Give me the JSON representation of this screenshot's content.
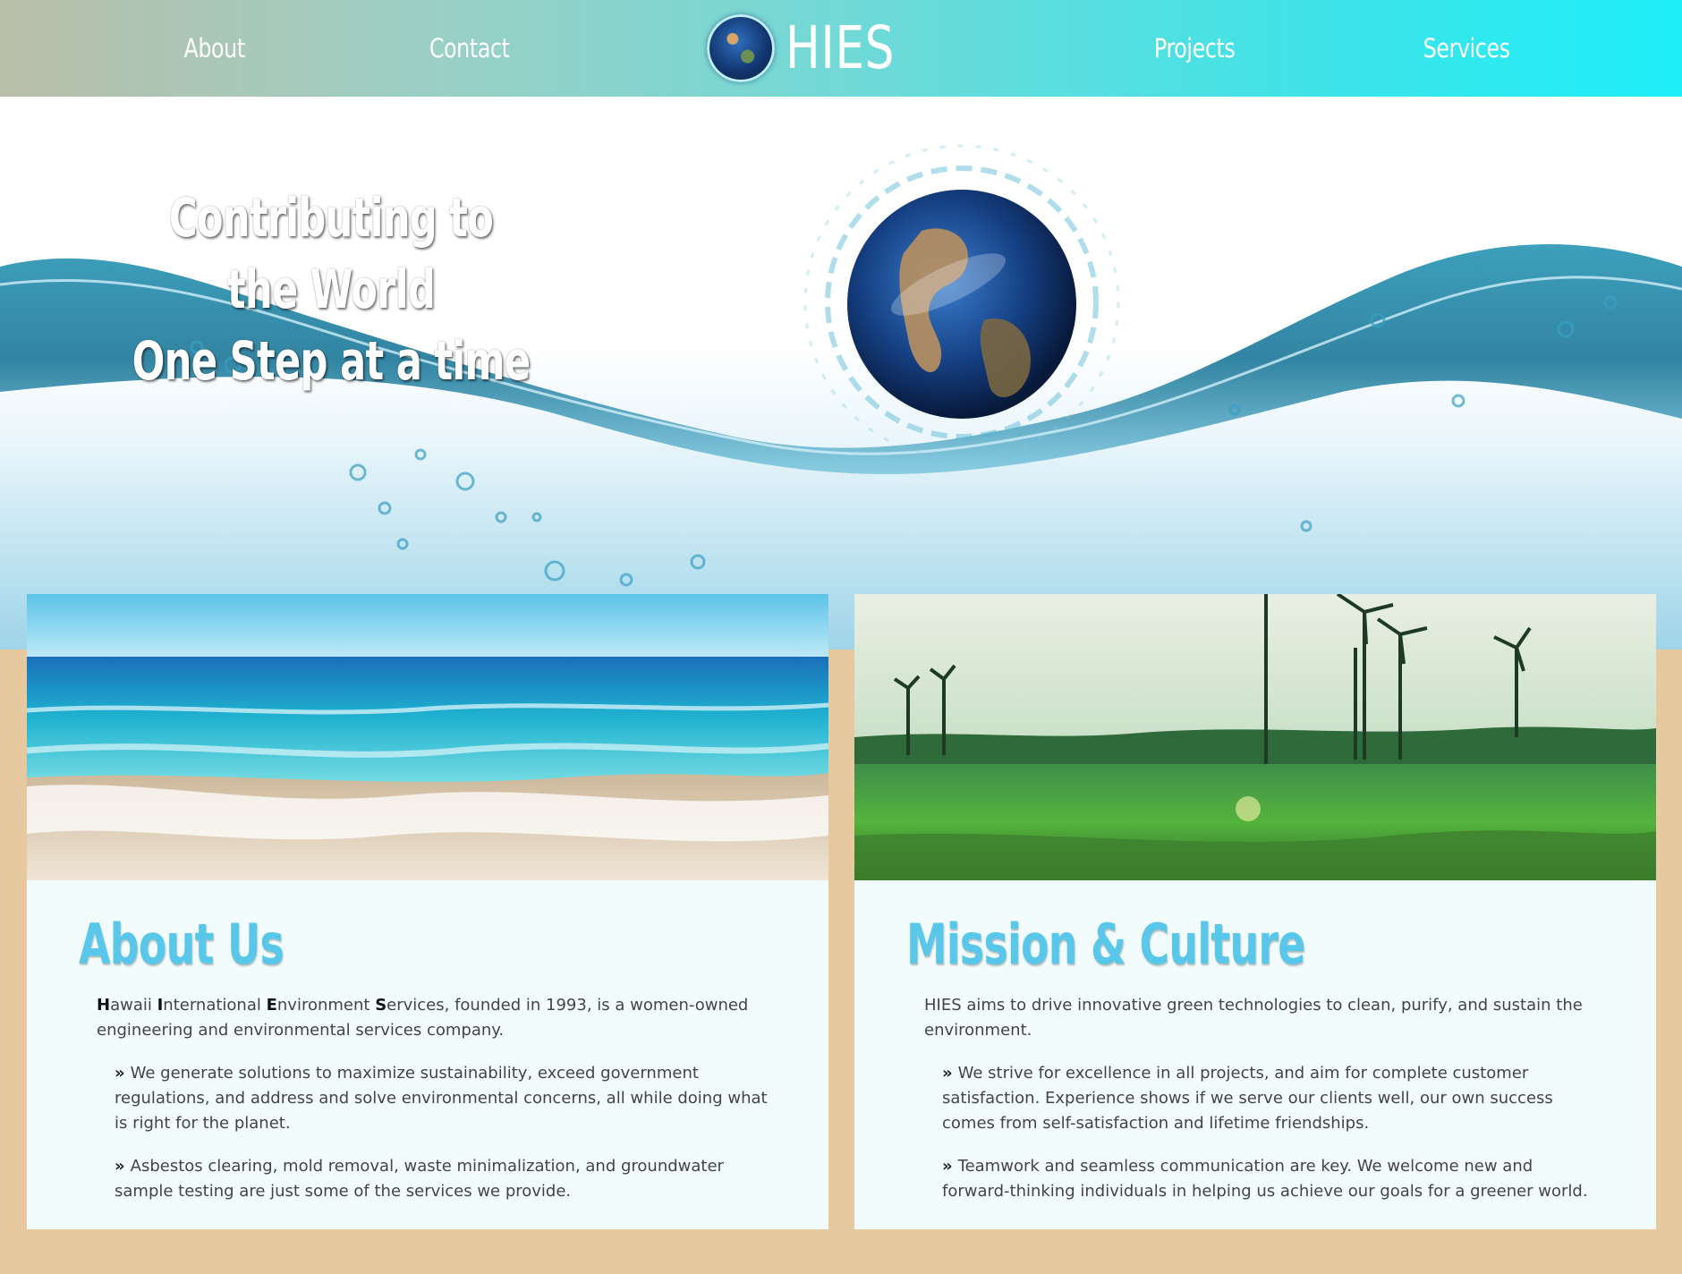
{
  "nav": {
    "links": [
      "About",
      "Contact",
      "Projects",
      "Services"
    ],
    "brand": "HIES",
    "brand_icon": "globe-icon"
  },
  "hero": {
    "line1": "Contributing to the World",
    "line2": "One Step at a time"
  },
  "about": {
    "title": "About Us",
    "intro_initials": [
      "H",
      "I",
      "E",
      "S"
    ],
    "intro_parts": [
      "awaii ",
      "nternational ",
      "nvironment ",
      "ervices, founded in 1993, is a women-owned engineering and environmental services company."
    ],
    "bullets": [
      "We generate solutions to maximize sustainability, exceed government regulations, and address and solve environmental concerns, all while doing what is right for the planet.",
      "Asbestos clearing, mold removal, waste minimalization, and groundwater sample testing are just some of the services we provide."
    ]
  },
  "mission": {
    "title": "Mission & Culture",
    "intro": "HIES aims to drive innovative green technologies to clean, purify, and sustain the environment.",
    "bullets": [
      "We strive for excellence in all projects, and aim for complete customer satisfaction. Experience shows if we serve our clients well, our own success comes from self-satisfaction and lifetime friendships.",
      "Teamwork and seamless communication are key. We welcome new and forward-thinking individuals in helping us achieve our goals for a greener world."
    ]
  },
  "bullet_icon": "chevron-double-right-icon",
  "colors": {
    "nav_start": "#b8bea8",
    "nav_end": "#1deef8",
    "title": "#59c7ea",
    "page_bg": "#e6c99f",
    "card_bg": "#f2fcfc"
  }
}
